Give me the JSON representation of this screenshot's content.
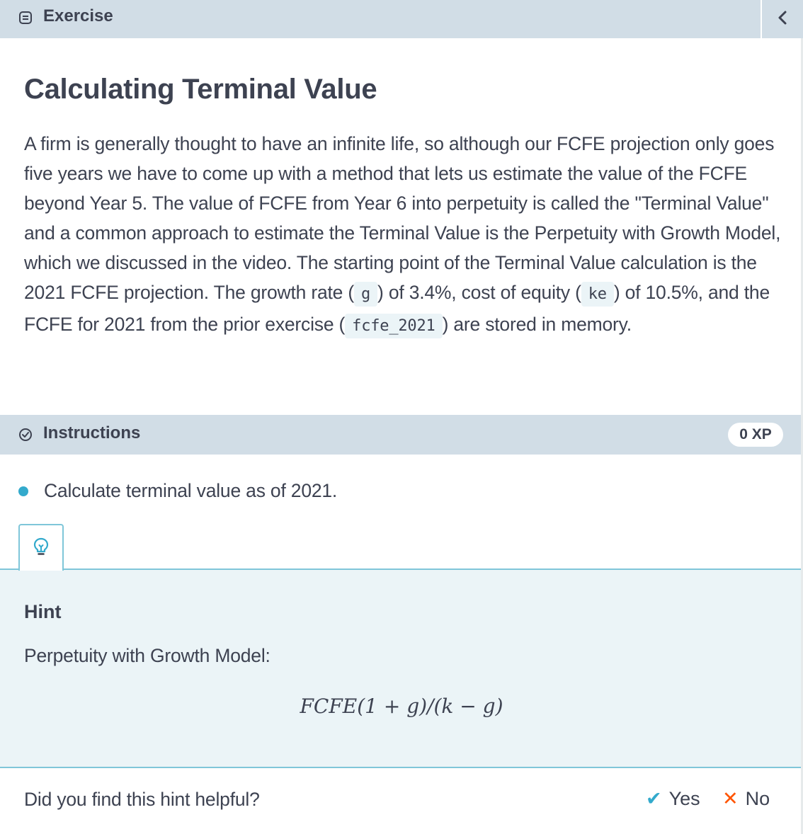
{
  "header": {
    "title": "Exercise",
    "icon": "exercise-icon",
    "collapse_icon": "chevron-left-icon"
  },
  "exercise": {
    "title": "Calculating Terminal Value",
    "description": {
      "p1": "A firm is generally thought to have an infinite life, so although our FCFE projection only goes five years we have to come up with a method that lets us estimate the value of the FCFE beyond Year 5. The value of FCFE from Year 6 into perpetuity is called the \"Terminal Value\" and a common approach to estimate the Terminal Value is the Perpetuity with Growth Model, which we discussed in the video. The starting point of the Terminal Value calculation is the 2021 FCFE projection. The growth rate (",
      "code_g": "g",
      "p2": ") of 3.4%, cost of equity (",
      "code_ke": "ke",
      "p3": ") of 10.5%, and the FCFE for 2021 from the prior exercise (",
      "code_fcfe": "fcfe_2021",
      "p4": ") are stored in memory."
    }
  },
  "instructions": {
    "title": "Instructions",
    "icon": "check-circle-icon",
    "xp": "0 XP",
    "items": [
      "Calculate terminal value as of 2021."
    ]
  },
  "hint": {
    "tab_icon": "lightbulb-icon",
    "title": "Hint",
    "text": "Perpetuity with Growth Model:",
    "formula": "FCFE(1 + g)/(k − g)"
  },
  "feedback": {
    "question": "Did you find this hint helpful?",
    "yes_label": "Yes",
    "no_label": "No",
    "colors": {
      "yes": "#33aacc",
      "no": "#ff5400"
    }
  },
  "colors": {
    "header_bg": "#d1dde6",
    "hint_bg": "#ebf4f7",
    "accent": "#33aacc",
    "text": "#3d4251"
  }
}
